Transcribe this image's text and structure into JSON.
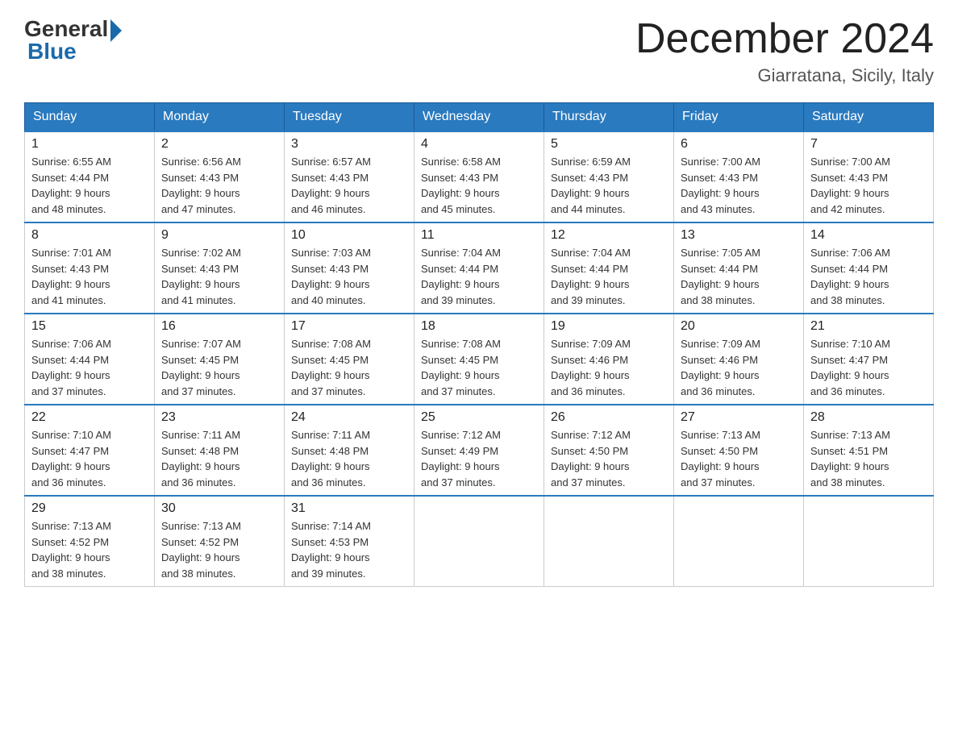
{
  "logo": {
    "general": "General",
    "blue": "Blue"
  },
  "title": "December 2024",
  "location": "Giarratana, Sicily, Italy",
  "days_of_week": [
    "Sunday",
    "Monday",
    "Tuesday",
    "Wednesday",
    "Thursday",
    "Friday",
    "Saturday"
  ],
  "weeks": [
    [
      {
        "day": "1",
        "sunrise": "6:55 AM",
        "sunset": "4:44 PM",
        "daylight": "9 hours and 48 minutes."
      },
      {
        "day": "2",
        "sunrise": "6:56 AM",
        "sunset": "4:43 PM",
        "daylight": "9 hours and 47 minutes."
      },
      {
        "day": "3",
        "sunrise": "6:57 AM",
        "sunset": "4:43 PM",
        "daylight": "9 hours and 46 minutes."
      },
      {
        "day": "4",
        "sunrise": "6:58 AM",
        "sunset": "4:43 PM",
        "daylight": "9 hours and 45 minutes."
      },
      {
        "day": "5",
        "sunrise": "6:59 AM",
        "sunset": "4:43 PM",
        "daylight": "9 hours and 44 minutes."
      },
      {
        "day": "6",
        "sunrise": "7:00 AM",
        "sunset": "4:43 PM",
        "daylight": "9 hours and 43 minutes."
      },
      {
        "day": "7",
        "sunrise": "7:00 AM",
        "sunset": "4:43 PM",
        "daylight": "9 hours and 42 minutes."
      }
    ],
    [
      {
        "day": "8",
        "sunrise": "7:01 AM",
        "sunset": "4:43 PM",
        "daylight": "9 hours and 41 minutes."
      },
      {
        "day": "9",
        "sunrise": "7:02 AM",
        "sunset": "4:43 PM",
        "daylight": "9 hours and 41 minutes."
      },
      {
        "day": "10",
        "sunrise": "7:03 AM",
        "sunset": "4:43 PM",
        "daylight": "9 hours and 40 minutes."
      },
      {
        "day": "11",
        "sunrise": "7:04 AM",
        "sunset": "4:44 PM",
        "daylight": "9 hours and 39 minutes."
      },
      {
        "day": "12",
        "sunrise": "7:04 AM",
        "sunset": "4:44 PM",
        "daylight": "9 hours and 39 minutes."
      },
      {
        "day": "13",
        "sunrise": "7:05 AM",
        "sunset": "4:44 PM",
        "daylight": "9 hours and 38 minutes."
      },
      {
        "day": "14",
        "sunrise": "7:06 AM",
        "sunset": "4:44 PM",
        "daylight": "9 hours and 38 minutes."
      }
    ],
    [
      {
        "day": "15",
        "sunrise": "7:06 AM",
        "sunset": "4:44 PM",
        "daylight": "9 hours and 37 minutes."
      },
      {
        "day": "16",
        "sunrise": "7:07 AM",
        "sunset": "4:45 PM",
        "daylight": "9 hours and 37 minutes."
      },
      {
        "day": "17",
        "sunrise": "7:08 AM",
        "sunset": "4:45 PM",
        "daylight": "9 hours and 37 minutes."
      },
      {
        "day": "18",
        "sunrise": "7:08 AM",
        "sunset": "4:45 PM",
        "daylight": "9 hours and 37 minutes."
      },
      {
        "day": "19",
        "sunrise": "7:09 AM",
        "sunset": "4:46 PM",
        "daylight": "9 hours and 36 minutes."
      },
      {
        "day": "20",
        "sunrise": "7:09 AM",
        "sunset": "4:46 PM",
        "daylight": "9 hours and 36 minutes."
      },
      {
        "day": "21",
        "sunrise": "7:10 AM",
        "sunset": "4:47 PM",
        "daylight": "9 hours and 36 minutes."
      }
    ],
    [
      {
        "day": "22",
        "sunrise": "7:10 AM",
        "sunset": "4:47 PM",
        "daylight": "9 hours and 36 minutes."
      },
      {
        "day": "23",
        "sunrise": "7:11 AM",
        "sunset": "4:48 PM",
        "daylight": "9 hours and 36 minutes."
      },
      {
        "day": "24",
        "sunrise": "7:11 AM",
        "sunset": "4:48 PM",
        "daylight": "9 hours and 36 minutes."
      },
      {
        "day": "25",
        "sunrise": "7:12 AM",
        "sunset": "4:49 PM",
        "daylight": "9 hours and 37 minutes."
      },
      {
        "day": "26",
        "sunrise": "7:12 AM",
        "sunset": "4:50 PM",
        "daylight": "9 hours and 37 minutes."
      },
      {
        "day": "27",
        "sunrise": "7:13 AM",
        "sunset": "4:50 PM",
        "daylight": "9 hours and 37 minutes."
      },
      {
        "day": "28",
        "sunrise": "7:13 AM",
        "sunset": "4:51 PM",
        "daylight": "9 hours and 38 minutes."
      }
    ],
    [
      {
        "day": "29",
        "sunrise": "7:13 AM",
        "sunset": "4:52 PM",
        "daylight": "9 hours and 38 minutes."
      },
      {
        "day": "30",
        "sunrise": "7:13 AM",
        "sunset": "4:52 PM",
        "daylight": "9 hours and 38 minutes."
      },
      {
        "day": "31",
        "sunrise": "7:14 AM",
        "sunset": "4:53 PM",
        "daylight": "9 hours and 39 minutes."
      },
      null,
      null,
      null,
      null
    ]
  ],
  "labels": {
    "sunrise": "Sunrise:",
    "sunset": "Sunset:",
    "daylight": "Daylight:"
  }
}
